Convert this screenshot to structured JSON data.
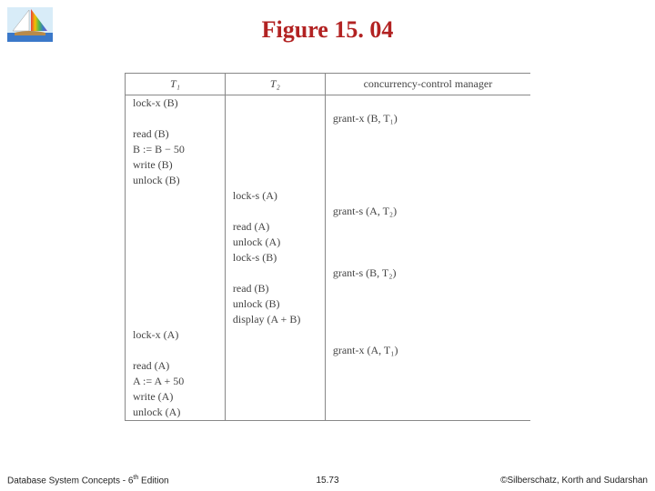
{
  "title": "Figure 15. 04",
  "table": {
    "headers": [
      "T₁",
      "T₂",
      "concurrency-control manager"
    ],
    "rows": [
      {
        "t1": "lock-x (B)",
        "t2": "",
        "mgr": ""
      },
      {
        "t1": "",
        "t2": "",
        "mgr": "grant-x (B, T₁)"
      },
      {
        "t1": "read (B)",
        "t2": "",
        "mgr": ""
      },
      {
        "t1": "B := B − 50",
        "t2": "",
        "mgr": ""
      },
      {
        "t1": "write (B)",
        "t2": "",
        "mgr": ""
      },
      {
        "t1": "unlock (B)",
        "t2": "",
        "mgr": ""
      },
      {
        "t1": "",
        "t2": "lock-s (A)",
        "mgr": ""
      },
      {
        "t1": "",
        "t2": "",
        "mgr": "grant-s (A, T₂)"
      },
      {
        "t1": "",
        "t2": "read (A)",
        "mgr": ""
      },
      {
        "t1": "",
        "t2": "unlock (A)",
        "mgr": ""
      },
      {
        "t1": "",
        "t2": "lock-s (B)",
        "mgr": ""
      },
      {
        "t1": "",
        "t2": "",
        "mgr": "grant-s (B, T₂)"
      },
      {
        "t1": "",
        "t2": "read (B)",
        "mgr": ""
      },
      {
        "t1": "",
        "t2": "unlock (B)",
        "mgr": ""
      },
      {
        "t1": "",
        "t2": "display (A + B)",
        "mgr": ""
      },
      {
        "t1": "lock-x (A)",
        "t2": "",
        "mgr": ""
      },
      {
        "t1": "",
        "t2": "",
        "mgr": "grant-x (A, T₁)"
      },
      {
        "t1": "read (A)",
        "t2": "",
        "mgr": ""
      },
      {
        "t1": "A := A + 50",
        "t2": "",
        "mgr": ""
      },
      {
        "t1": "write (A)",
        "t2": "",
        "mgr": ""
      },
      {
        "t1": "unlock (A)",
        "t2": "",
        "mgr": ""
      }
    ]
  },
  "footer": {
    "left_a": "Database System Concepts - 6",
    "left_sup": "th",
    "left_b": " Edition",
    "center": "15.73",
    "right": "©Silberschatz, Korth and Sudarshan"
  }
}
